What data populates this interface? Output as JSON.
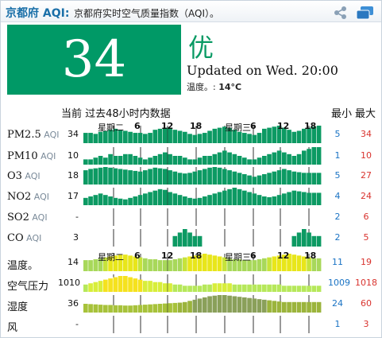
{
  "header": {
    "city": "京都府 AQI:",
    "description": "京都府实时空气质量指数（AQI）。"
  },
  "current": {
    "aqi": "34",
    "level": "优",
    "updated": "Updated on Wed. 20:00",
    "temperature_label": "温度。: ",
    "temperature_value": "14°C",
    "aqi_color": "#009966"
  },
  "table": {
    "title": "当前 过去48小时内数据",
    "min_header": "最小",
    "max_header": "最大",
    "day_labels_1": [
      "星期二",
      "6",
      "12",
      "18",
      "星期三",
      "6",
      "12",
      "18"
    ],
    "day_labels_2": [
      "星期二",
      "6",
      "12",
      "18",
      "星期三",
      "6",
      "12",
      "18"
    ],
    "rows": [
      {
        "name": "PM2.5",
        "unit": "AQI",
        "current": "34",
        "min": "5",
        "max": "34",
        "values": [
          20,
          20,
          18,
          22,
          24,
          26,
          28,
          26,
          24,
          22,
          20,
          20,
          18,
          20,
          26,
          28,
          30,
          28,
          26,
          24,
          22,
          18,
          16,
          18,
          20,
          24,
          28,
          30,
          32,
          30,
          26,
          22,
          20,
          18,
          16,
          20,
          28,
          30,
          32,
          34,
          30,
          26,
          22,
          24,
          28,
          30,
          32,
          34
        ]
      },
      {
        "name": "PM10",
        "unit": "AQI",
        "current": "10",
        "min": "1",
        "max": "10",
        "values": [
          3,
          3,
          4,
          5,
          4,
          6,
          5,
          5,
          6,
          6,
          5,
          4,
          3,
          4,
          5,
          6,
          7,
          6,
          5,
          5,
          4,
          3,
          3,
          4,
          5,
          5,
          6,
          7,
          8,
          7,
          6,
          5,
          4,
          3,
          3,
          4,
          5,
          6,
          7,
          8,
          7,
          6,
          5,
          6,
          8,
          9,
          10,
          10
        ]
      },
      {
        "name": "O3",
        "unit": "AQI",
        "current": "18",
        "min": "5",
        "max": "27",
        "values": [
          22,
          24,
          25,
          26,
          27,
          26,
          25,
          24,
          23,
          22,
          21,
          20,
          22,
          24,
          26,
          25,
          24,
          22,
          20,
          18,
          17,
          18,
          20,
          22,
          24,
          26,
          27,
          26,
          24,
          22,
          20,
          18,
          16,
          14,
          12,
          14,
          16,
          18,
          20,
          22,
          24,
          22,
          20,
          19,
          18,
          18,
          18,
          18
        ]
      },
      {
        "name": "NO2",
        "unit": "AQI",
        "current": "17",
        "min": "4",
        "max": "24",
        "values": [
          10,
          12,
          14,
          16,
          14,
          12,
          10,
          9,
          8,
          10,
          12,
          14,
          16,
          18,
          20,
          22,
          21,
          18,
          16,
          14,
          12,
          10,
          9,
          10,
          12,
          14,
          16,
          18,
          20,
          22,
          24,
          22,
          20,
          18,
          16,
          14,
          12,
          11,
          12,
          14,
          16,
          18,
          20,
          19,
          18,
          17,
          17,
          17
        ]
      },
      {
        "name": "SO2",
        "unit": "AQI",
        "current": "-",
        "min": "2",
        "max": "6",
        "values": []
      },
      {
        "name": "CO",
        "unit": "AQI",
        "current": "3",
        "min": "2",
        "max": "5",
        "values": [
          0,
          0,
          0,
          0,
          0,
          0,
          0,
          0,
          0,
          0,
          0,
          0,
          0,
          0,
          0,
          0,
          0,
          0,
          3,
          4,
          5,
          4,
          3,
          3,
          0,
          0,
          0,
          0,
          0,
          0,
          0,
          0,
          0,
          0,
          0,
          0,
          0,
          0,
          0,
          0,
          0,
          0,
          3,
          4,
          5,
          4,
          3,
          3
        ]
      },
      {
        "name": "温度。",
        "unit": "",
        "current": "14",
        "min": "11",
        "max": "19",
        "values": [
          12,
          12,
          13,
          14,
          15,
          16,
          17,
          18,
          18,
          17,
          16,
          15,
          14,
          13,
          13,
          12,
          12,
          12,
          13,
          14,
          15,
          16,
          17,
          18,
          19,
          18,
          17,
          16,
          15,
          14,
          13,
          13,
          12,
          12,
          12,
          13,
          14,
          15,
          16,
          17,
          18,
          19,
          18,
          17,
          16,
          15,
          14,
          14
        ]
      },
      {
        "name": "空气压力",
        "unit": "",
        "current": "1010",
        "min": "1009",
        "max": "1018",
        "values": [
          1011,
          1012,
          1013,
          1014,
          1015,
          1016,
          1017,
          1018,
          1018,
          1017,
          1016,
          1015,
          1014,
          1014,
          1013,
          1013,
          1012,
          1012,
          1011,
          1011,
          1010,
          1010,
          1010,
          1010,
          1011,
          1011,
          1012,
          1012,
          1012,
          1012,
          1011,
          1011,
          1011,
          1011,
          1011,
          1011,
          1011,
          1011,
          1011,
          1011,
          1010,
          1010,
          1010,
          1010,
          1010,
          1010,
          1010,
          1010
        ]
      },
      {
        "name": "湿度",
        "unit": "",
        "current": "36",
        "min": "24",
        "max": "60",
        "values": [
          30,
          29,
          28,
          27,
          26,
          26,
          25,
          25,
          24,
          24,
          25,
          26,
          27,
          28,
          29,
          30,
          31,
          32,
          33,
          34,
          36,
          40,
          44,
          48,
          52,
          56,
          58,
          60,
          60,
          58,
          56,
          54,
          52,
          50,
          48,
          46,
          44,
          42,
          40,
          38,
          36,
          36,
          36,
          36,
          36,
          36,
          36,
          36
        ]
      },
      {
        "name": "风",
        "unit": "",
        "current": "-",
        "min": "1",
        "max": "3",
        "values": []
      }
    ]
  }
}
